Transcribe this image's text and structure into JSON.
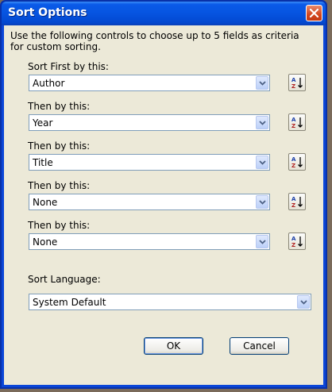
{
  "window": {
    "title": "Sort Options"
  },
  "description": "Use the following controls to choose up to 5 fields as criteria for custom sorting.",
  "sort_fields": [
    {
      "label": "Sort First by this:",
      "value": "Author"
    },
    {
      "label": "Then by this:",
      "value": "Year"
    },
    {
      "label": "Then by this:",
      "value": "Title"
    },
    {
      "label": "Then by this:",
      "value": "None"
    },
    {
      "label": "Then by this:",
      "value": "None"
    }
  ],
  "sort_language": {
    "label": "Sort Language:",
    "value": "System Default"
  },
  "buttons": {
    "ok": "OK",
    "cancel": "Cancel"
  },
  "icons": {
    "close": "close-icon",
    "sort_order": "sort-az-icon",
    "dropdown": "chevron-down-icon"
  },
  "colors": {
    "titlebar": "#0654e0",
    "close": "#d3461e",
    "dialog_bg": "#ece9d8",
    "field_border": "#7f9db9"
  }
}
